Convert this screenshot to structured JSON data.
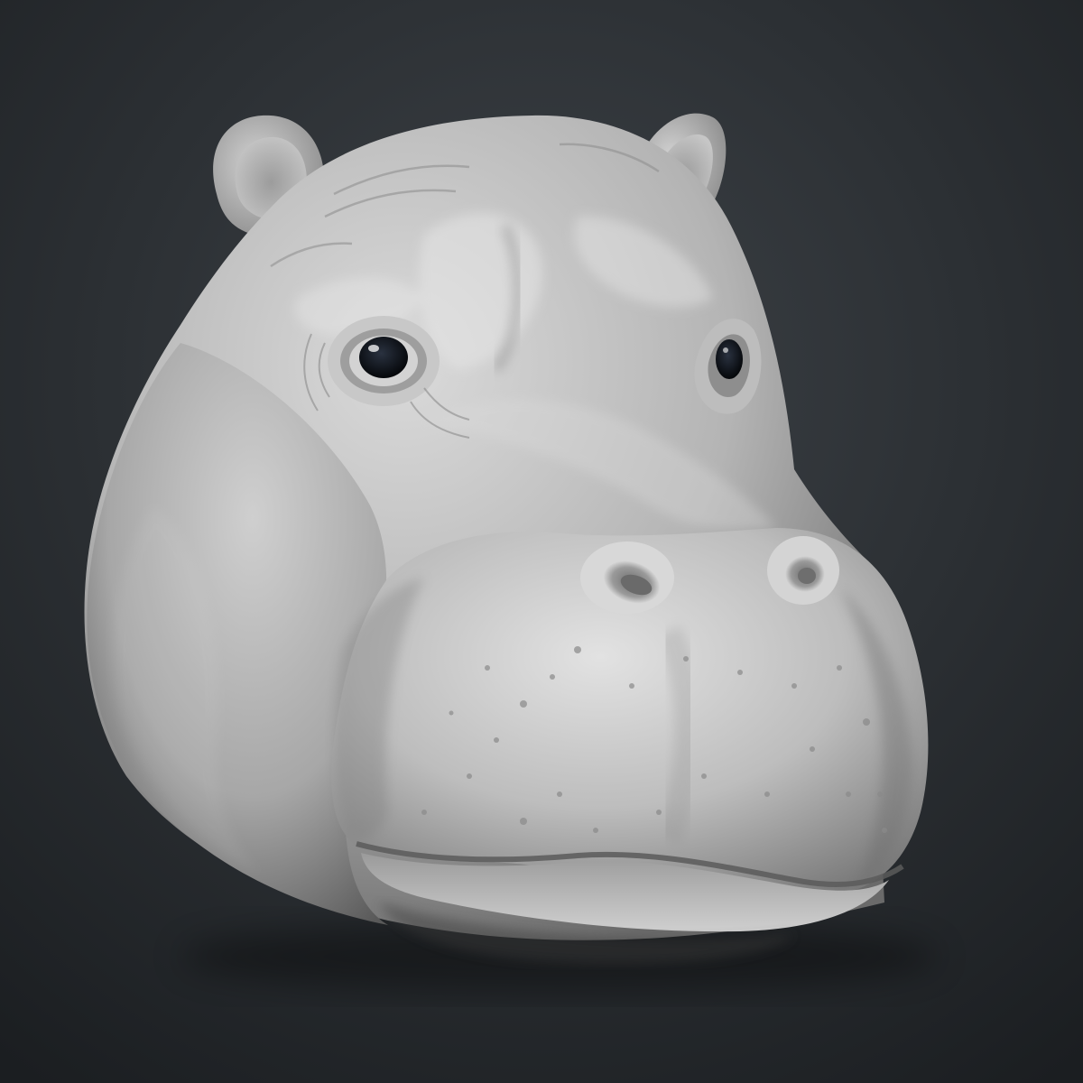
{
  "scene": {
    "subject": "hippo-head-sculpt",
    "colors": {
      "background_top": "#3a3f44",
      "background_bottom": "#1c1f22",
      "clay_light": "#d9d9d9",
      "clay_mid": "#a8a8a8",
      "clay_dark": "#5e5e5e",
      "eye": "#0a0c10"
    }
  }
}
